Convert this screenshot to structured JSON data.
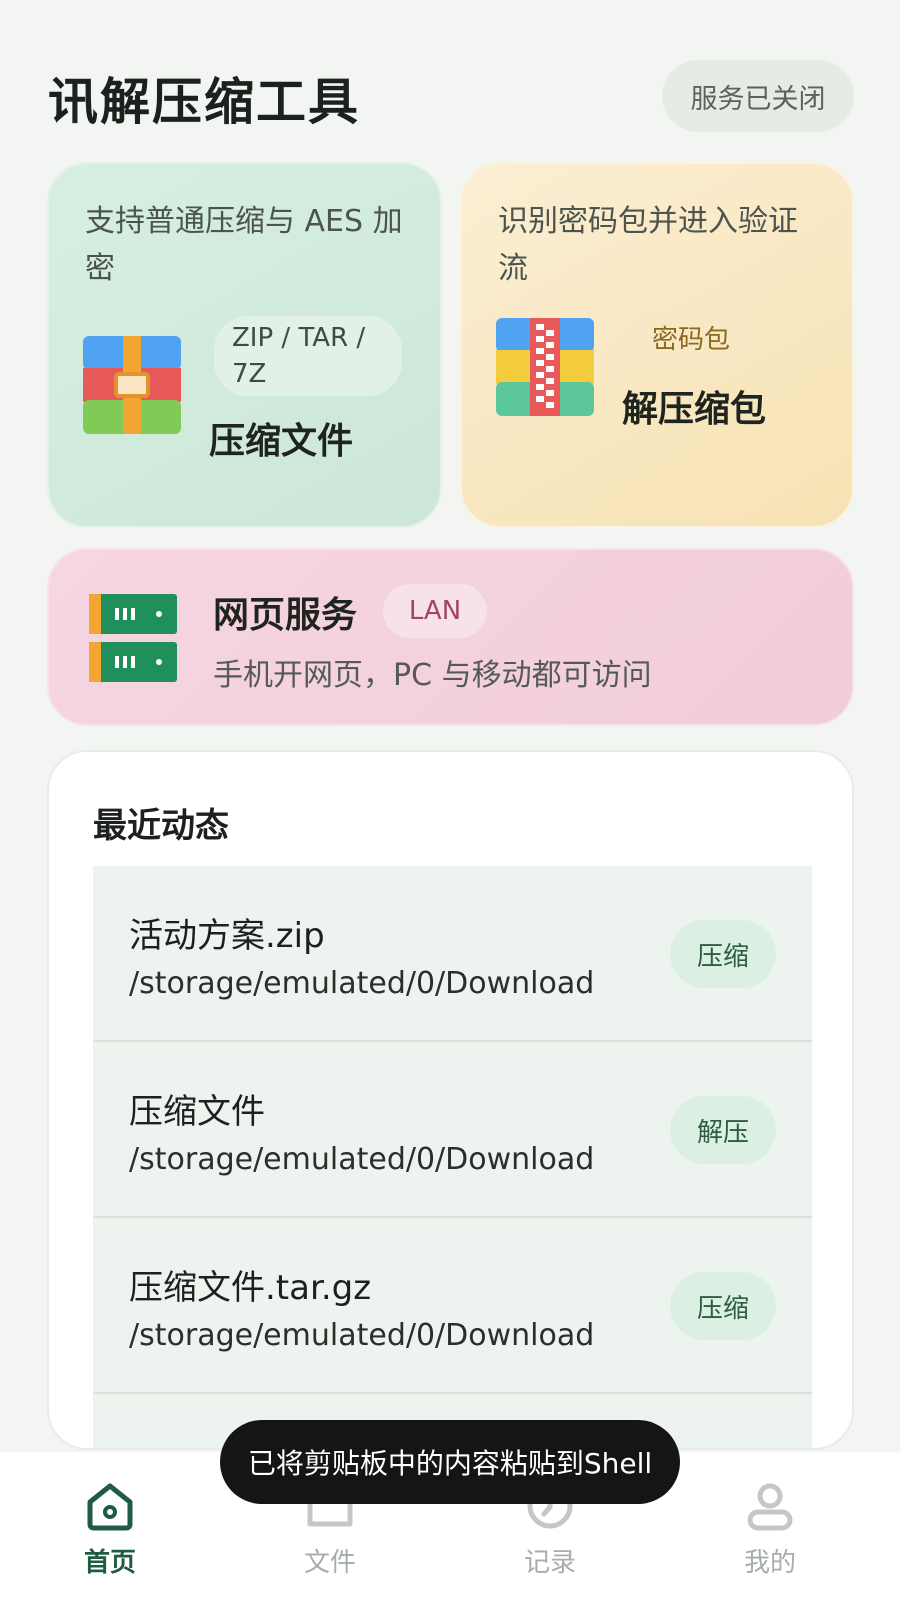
{
  "header": {
    "title": "讯解压缩工具",
    "service_status": "服务已关闭"
  },
  "cards": {
    "compress": {
      "desc": "支持普通压缩与 AES 加密",
      "tag": "ZIP / TAR / 7Z",
      "label": "压缩文件"
    },
    "extract": {
      "desc": "识别密码包并进入验证流",
      "tag": "密码包",
      "label": "解压缩包"
    },
    "web": {
      "title": "网页服务",
      "tag": "LAN",
      "desc": "手机开网页，PC 与移动都可访问"
    }
  },
  "recent": {
    "title": "最近动态",
    "items": [
      {
        "name": "活动方案.zip",
        "path": "/storage/emulated/0/Download",
        "action": "压缩"
      },
      {
        "name": "压缩文件",
        "path": "/storage/emulated/0/Download",
        "action": "解压"
      },
      {
        "name": "压缩文件.tar.gz",
        "path": "/storage/emulated/0/Download",
        "action": "压缩"
      }
    ]
  },
  "toast": "已将剪贴板中的内容粘贴到Shell",
  "nav": [
    {
      "label": "首页",
      "icon": "home-icon",
      "active": true
    },
    {
      "label": "文件",
      "icon": "folder-icon",
      "active": false
    },
    {
      "label": "记录",
      "icon": "history-icon",
      "active": false
    },
    {
      "label": "我的",
      "icon": "profile-icon",
      "active": false
    }
  ],
  "colors": {
    "accent": "#1f5c42",
    "compress_card": "#d3ecdf",
    "extract_card": "#f9e8c4",
    "web_card": "#f4d2de"
  }
}
